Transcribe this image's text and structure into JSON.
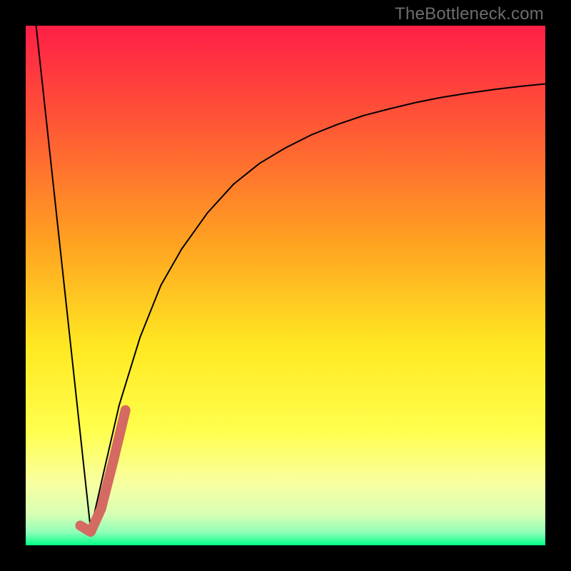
{
  "watermark": "TheBottleneck.com",
  "chart_data": {
    "type": "line",
    "title": "",
    "xlabel": "",
    "ylabel": "",
    "xlim": [
      0,
      100
    ],
    "ylim": [
      0,
      100
    ],
    "grid": false,
    "legend": false,
    "background_gradient_stops": [
      {
        "offset": 0.0,
        "color": "#ff1f47"
      },
      {
        "offset": 0.2,
        "color": "#ff5a35"
      },
      {
        "offset": 0.42,
        "color": "#ffa321"
      },
      {
        "offset": 0.62,
        "color": "#ffe922"
      },
      {
        "offset": 0.78,
        "color": "#ffff4e"
      },
      {
        "offset": 0.88,
        "color": "#f8ffa0"
      },
      {
        "offset": 0.94,
        "color": "#d8ffb4"
      },
      {
        "offset": 0.975,
        "color": "#90ffb8"
      },
      {
        "offset": 1.0,
        "color": "#00ff87"
      }
    ],
    "series": [
      {
        "name": "left-line",
        "color": "#000000",
        "width": 2.0,
        "x": [
          2,
          12.5
        ],
        "y": [
          100,
          3
        ]
      },
      {
        "name": "right-curve",
        "color": "#000000",
        "width": 2.0,
        "x": [
          12.5,
          15,
          18,
          22,
          26,
          30,
          35,
          40,
          45,
          50,
          55,
          60,
          65,
          70,
          75,
          80,
          85,
          90,
          95,
          100
        ],
        "y": [
          3,
          14,
          27,
          40,
          50,
          57,
          64,
          69.5,
          73.5,
          76.5,
          79,
          81,
          82.7,
          84,
          85.2,
          86.2,
          87,
          87.7,
          88.3,
          88.8
        ]
      },
      {
        "name": "highlight-segment",
        "color": "#d46a61",
        "width": 14,
        "linecap": "round",
        "x": [
          10.5,
          12.5,
          14.5,
          16.8,
          19.2
        ],
        "y": [
          3.8,
          2.6,
          7,
          16,
          26
        ]
      }
    ]
  }
}
